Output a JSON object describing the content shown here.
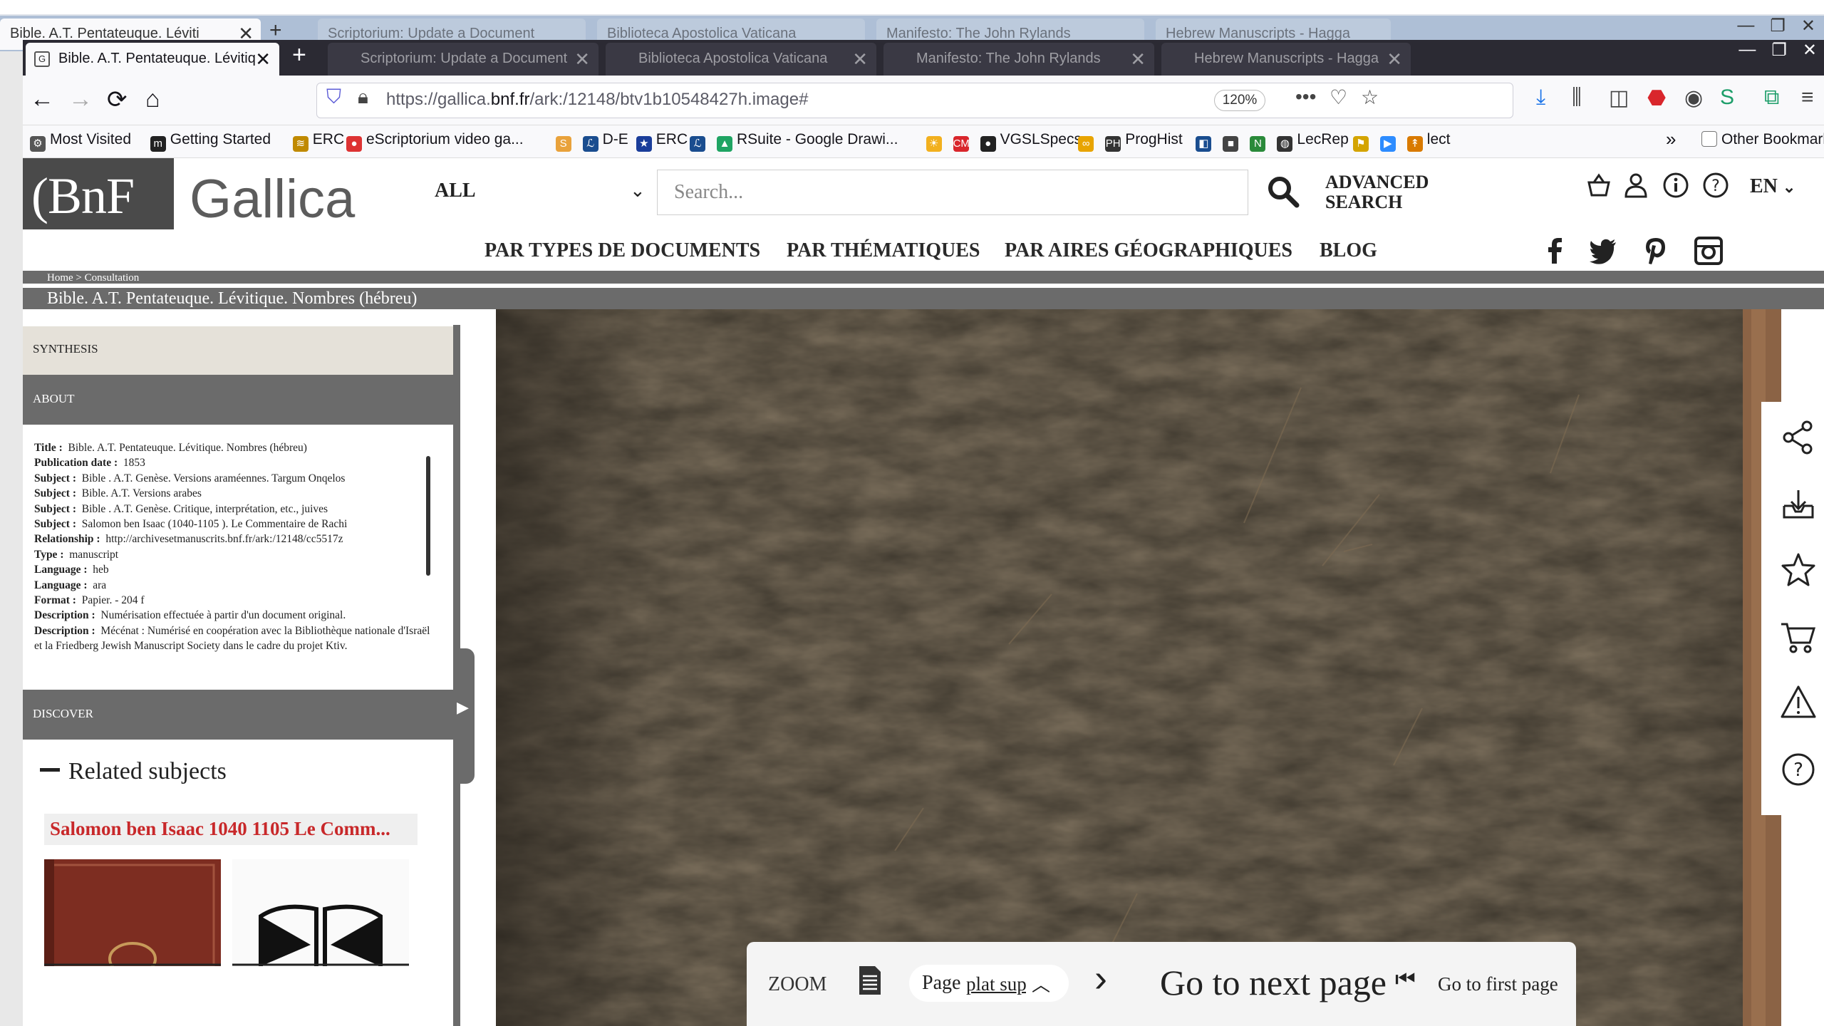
{
  "background_window": {
    "tab_title": "Bible. A.T. Pentateuque. Léviti",
    "other_tabs": [
      "Scriptorium: Update a Document",
      "Biblioteca Apostolica Vaticana",
      "Manifesto: The John Rylands",
      "Hebrew Manuscripts - Hagga"
    ]
  },
  "browser": {
    "tabs": [
      {
        "title": "Bible. A.T. Pentateuque. Lévitiq",
        "active": true
      },
      {
        "title": "Scriptorium: Update a Document",
        "active": false
      },
      {
        "title": "Biblioteca Apostolica Vaticana",
        "active": false
      },
      {
        "title": "Manifesto: The John Rylands",
        "active": false
      },
      {
        "title": "Hebrew Manuscripts - Hagga",
        "active": false
      }
    ],
    "url_prefix": "https://gallica.",
    "url_domain": "bnf.fr",
    "url_path": "/ark:/12148/btv1b10548427h.image#",
    "zoom": "120%",
    "bookmarks": [
      {
        "label": "Most Visited",
        "icon": "gear-icon",
        "color": "#555555"
      },
      {
        "label": "Getting Started",
        "icon": "m-icon",
        "color": "#222222"
      },
      {
        "label": "ERC",
        "icon": "stack-icon",
        "color": "#c08a00"
      },
      {
        "label": "eScriptorium video ga...",
        "icon": "pin-icon",
        "color": "#d33"
      },
      {
        "label": "",
        "icon": "ss-icon",
        "color": "#e9a23b"
      },
      {
        "label": "D-E",
        "icon": "script-icon",
        "color": "#1a4d8f"
      },
      {
        "label": "ERC",
        "icon": "eu-icon",
        "color": "#1a3d9a"
      },
      {
        "label": "",
        "icon": "script-icon",
        "color": "#1a4d8f"
      },
      {
        "label": "RSuite - Google Drawi...",
        "icon": "drive-icon",
        "color": "#1fa463"
      },
      {
        "label": "",
        "icon": "sun-icon",
        "color": "#f2b01e"
      },
      {
        "label": "",
        "icon": "cm-icon",
        "color": "#d9262c"
      },
      {
        "label": "VGSLSpecs",
        "icon": "github-icon",
        "color": "#222222"
      },
      {
        "label": "",
        "icon": "infinity-icon",
        "color": "#e8a400"
      },
      {
        "label": "ProgHist",
        "icon": "ph-icon",
        "color": "#333333"
      },
      {
        "label": "",
        "icon": "ms-icon",
        "color": "#1a4d8f"
      },
      {
        "label": "",
        "icon": "cube-icon",
        "color": "#444444"
      },
      {
        "label": "",
        "icon": "not-icon",
        "color": "#2a8a3a"
      },
      {
        "label": "LecRep",
        "icon": "globe-icon",
        "color": "#333333"
      },
      {
        "label": "",
        "icon": "flag-icon",
        "color": "#d4a400"
      },
      {
        "label": "",
        "icon": "zoom-icon",
        "color": "#2d8cff"
      },
      {
        "label": "lect",
        "icon": "lect-icon",
        "color": "#d97a00"
      }
    ],
    "overflow_label": "»",
    "other_bookmarks": "Other Bookmarks"
  },
  "gallica": {
    "logo_bnf": "(BnF",
    "logo_gallica": "Gallica",
    "scope": "ALL",
    "search_placeholder": "Search...",
    "advanced_search": "ADVANCED SEARCH",
    "lang": "EN",
    "nav": [
      "PAR TYPES DE DOCUMENTS",
      "PAR THÉMATIQUES",
      "PAR AIRES GÉOGRAPHIQUES",
      "BLOG"
    ],
    "breadcrumb_home": "Home",
    "breadcrumb_sep": ">",
    "breadcrumb_current": "Consultation",
    "doc_title": "Bible. A.T. Pentateuque. Lévitique. Nombres (hébreu)"
  },
  "left_panel": {
    "synthesis": "SYNTHESIS",
    "about": "ABOUT",
    "discover": "DISCOVER",
    "info": [
      {
        "k": "Title :",
        "v": "Bible. A.T. Pentateuque. Lévitique. Nombres (hébreu)"
      },
      {
        "k": "Publication date :",
        "v": "1853"
      },
      {
        "k": "Subject :",
        "v": "Bible . A.T. Genèse. Versions araméennes. Targum Onqelos"
      },
      {
        "k": "Subject :",
        "v": "Bible. A.T. Versions arabes"
      },
      {
        "k": "Subject :",
        "v": "Bible . A.T. Genèse. Critique, interprétation, etc., juives"
      },
      {
        "k": "Subject :",
        "v": "Salomon ben Isaac (1040-1105 ). Le Commentaire de Rachi"
      },
      {
        "k": "Relationship :",
        "v": "http://archivesetmanuscrits.bnf.fr/ark:/12148/cc5517z"
      },
      {
        "k": "Type :",
        "v": "manuscript"
      },
      {
        "k": "Language :",
        "v": "heb"
      },
      {
        "k": "Language :",
        "v": "ara"
      },
      {
        "k": "Format :",
        "v": "Papier. - 204 f"
      },
      {
        "k": "Description :",
        "v": "Numérisation effectuée à partir d'un document original."
      },
      {
        "k": "Description :",
        "v": "Mécénat : Numérisé en coopération avec la Bibliothèque nationale d'Israël et la Friedberg Jewish Manuscript Society dans le cadre du projet Ktiv."
      }
    ],
    "related_title": "Related subjects",
    "related_chip": "Salomon ben Isaac 1040 1105 Le Comm..."
  },
  "viewer": {
    "zoom_label": "ZOOM",
    "page_label": "Page",
    "page_value": "plat sup",
    "next_page": "Go to next page",
    "first_page": "Go to first page"
  },
  "colors": {
    "panel_grey": "#6b6b6b",
    "synthesis_bg": "#e5e1d9",
    "related_red": "#c8282a",
    "cover_dark": "#3d372d"
  }
}
